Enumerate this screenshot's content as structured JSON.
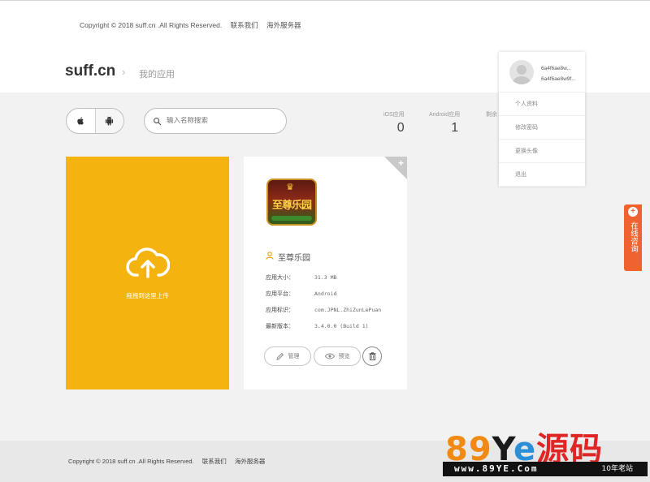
{
  "top": {
    "copyright": "Copyright © 2018 suff.cn .All Rights Reserved.",
    "links": [
      "联系我们",
      "海外服务器"
    ]
  },
  "header": {
    "brand": "suff.cn",
    "breadcrumb_sep": "›",
    "breadcrumb": "我的应用"
  },
  "toolbar": {
    "search_placeholder": "输入名称搜索"
  },
  "stats": [
    {
      "label": "iOS应用",
      "value": "0"
    },
    {
      "label": "Android应用",
      "value": "1"
    },
    {
      "label": "剩余",
      "value": ""
    }
  ],
  "upload": {
    "hint": "拖拽到这里上传"
  },
  "app": {
    "icon_text": "至尊乐园",
    "name": "至尊乐园",
    "info": [
      {
        "key": "应用大小：",
        "value": "31.3 MB"
      },
      {
        "key": "应用平台：",
        "value": "Android"
      },
      {
        "key": "应用标识：",
        "value": "com.JPNL.ZhiZunLePuan"
      },
      {
        "key": "最新版本：",
        "value": "3.4.0.0 (Build 1)"
      }
    ],
    "manage_label": "管理",
    "preview_label": "预览"
  },
  "user_menu": {
    "user_line1": "6a4f6ae8w...",
    "user_line2": "6a4f6ae8w9f...",
    "items": [
      "个人资料",
      "修改密码",
      "更换头像",
      "退出"
    ]
  },
  "consult": {
    "label": "在线咨询"
  },
  "footer": {
    "copyright": "Copyright © 2018 suff.cn .All Rights Reserved.",
    "links": [
      "联系我们",
      "海外服务器"
    ]
  },
  "watermark": {
    "logo_a": "89",
    "logo_b": "Y",
    "logo_c": "e",
    "logo_d": "源码",
    "site": "www.89YE.Com",
    "tag": "10年老站"
  },
  "colors": {
    "upload_card": "#f5b30f",
    "consult": "#f0622e",
    "page_bg": "#f2f2f2"
  }
}
